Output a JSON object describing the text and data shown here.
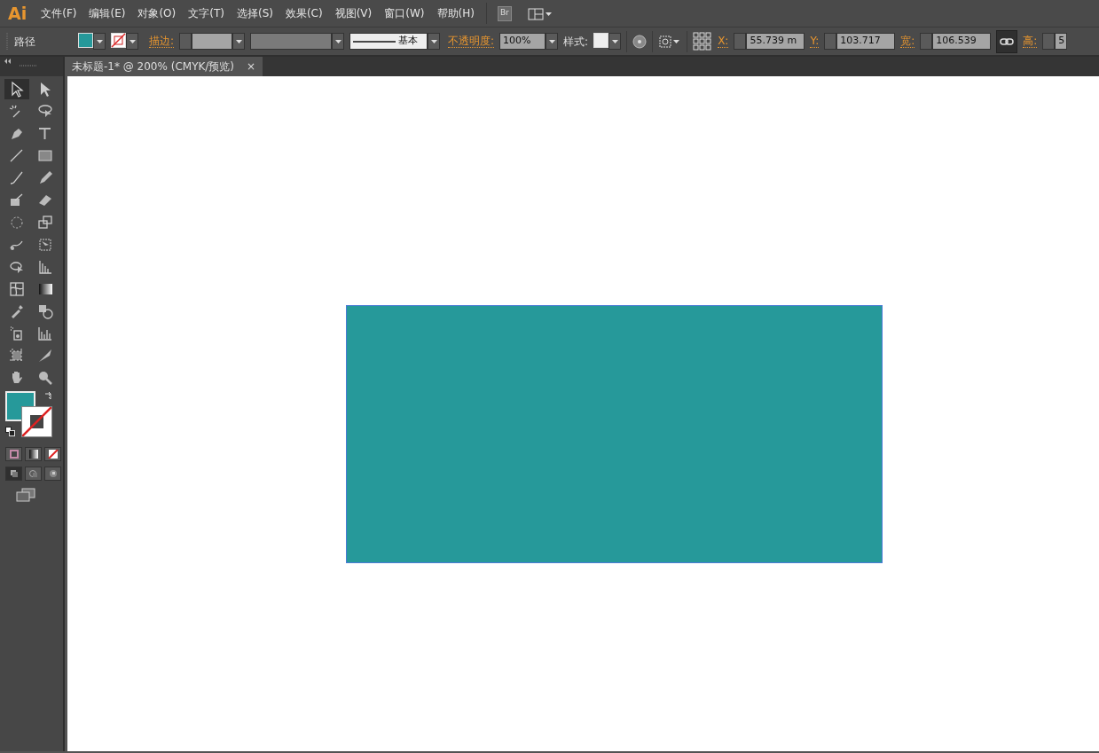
{
  "app_logo": "Ai",
  "menu": [
    "文件(F)",
    "编辑(E)",
    "对象(O)",
    "文字(T)",
    "选择(S)",
    "效果(C)",
    "视图(V)",
    "窗口(W)",
    "帮助(H)"
  ],
  "bridge_button": "Br",
  "control_bar": {
    "object_type": "路径",
    "stroke_label": "描边:",
    "stroke_profile": "基本",
    "opacity_label": "不透明度:",
    "opacity": "100%",
    "style_label": "样式:",
    "fields": [
      {
        "label": "X:",
        "value": "55.739 m"
      },
      {
        "label": "Y:",
        "value": "103.717"
      },
      {
        "label": "宽:",
        "value": "106.539"
      },
      {
        "label": "高:",
        "value": "5"
      }
    ]
  },
  "document_tab": {
    "title": "未标题-1* @ 200% (CMYK/预览)",
    "close": "×"
  },
  "tools": [
    {
      "selected": true
    },
    {
      "selected": false
    },
    {
      "selected": false
    },
    {
      "selected": false
    },
    {
      "selected": false
    },
    {
      "selected": false
    },
    {
      "selected": false
    },
    {
      "selected": false
    },
    {
      "selected": false
    },
    {
      "selected": false
    },
    {
      "selected": false
    },
    {
      "selected": false
    },
    {
      "selected": false
    },
    {
      "selected": false
    },
    {
      "selected": false
    },
    {
      "selected": false
    },
    {
      "selected": false
    },
    {
      "selected": false
    },
    {
      "selected": false
    },
    {
      "selected": false
    },
    {
      "selected": false
    },
    {
      "selected": false
    },
    {
      "selected": false
    },
    {
      "selected": false
    },
    {
      "selected": false
    },
    {
      "selected": false
    },
    {
      "selected": false
    },
    {
      "selected": false
    }
  ],
  "draw_modes": [
    {
      "selected": true
    },
    {
      "selected": false
    },
    {
      "selected": false
    }
  ]
}
